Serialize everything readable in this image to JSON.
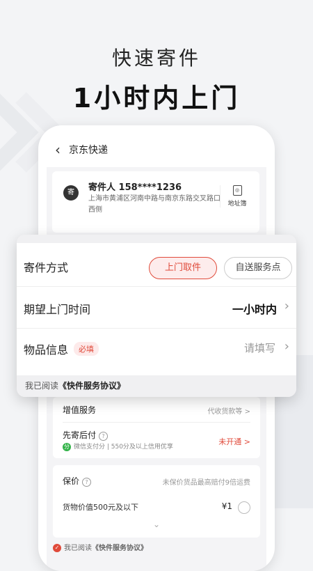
{
  "hero": {
    "subtitle": "快速寄件",
    "title": "1小时内上门"
  },
  "phone": {
    "header_title": "京东快递",
    "sender": {
      "icon_char": "寄",
      "name_line": "寄件人  158****1236",
      "address": "上海市黄浦区河南中路与南京东路交叉路口西侧",
      "address_book_label": "地址簿"
    }
  },
  "overlay": {
    "method_label": "寄件方式",
    "pickup_label": "上门取件",
    "selfdrop_label": "自送服务点",
    "time_label": "期望上门时间",
    "time_value": "一小时内",
    "item_label": "物品信息",
    "required_label": "必填",
    "item_placeholder": "请填写",
    "agreement_prefix": "我已阅读",
    "agreement_link": "《快件服务协议》"
  },
  "services": {
    "value_added_label": "增值服务",
    "value_added_value": "代收货款等 >",
    "pay_later_label": "先寄后付",
    "pay_later_help": "?",
    "wechat_icon_char": "分",
    "credit_desc": "微信支付分 | 550分及以上信用优享",
    "not_opened": "未开通 >"
  },
  "insurance": {
    "label": "保价",
    "help": "?",
    "note": "未保价货品最高赔付9倍运费",
    "option_label": "货物价值500元及以下",
    "option_price": "¥1",
    "expand": "⌄"
  },
  "bottom": {
    "check_char": "✓",
    "agree_prefix": "我已阅读",
    "agree_link": "《快件服务协议》"
  },
  "colors": {
    "accent": "#e04a3a",
    "accent_bg": "#fdecec",
    "background": "#f3f4f6"
  }
}
